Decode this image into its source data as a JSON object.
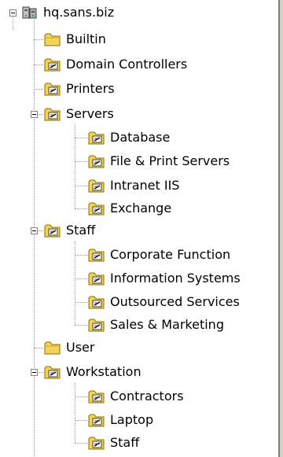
{
  "tree": {
    "root": {
      "label": "hq.sans.biz",
      "icon": "domain-icon"
    },
    "builtin": {
      "label": "Builtin",
      "icon": "folder-icon"
    },
    "domain_controllers": {
      "label": "Domain Controllers",
      "icon": "ou-folder-icon"
    },
    "printers": {
      "label": "Printers",
      "icon": "ou-folder-icon"
    },
    "servers": {
      "label": "Servers",
      "icon": "ou-folder-icon",
      "children": [
        {
          "label": "Database"
        },
        {
          "label": "File & Print Servers"
        },
        {
          "label": "Intranet IIS"
        },
        {
          "label": "Exchange"
        }
      ]
    },
    "staff": {
      "label": "Staff",
      "icon": "ou-folder-icon",
      "children": [
        {
          "label": "Corporate Function"
        },
        {
          "label": "Information Systems"
        },
        {
          "label": "Outsourced Services"
        },
        {
          "label": "Sales & Marketing"
        }
      ]
    },
    "user": {
      "label": "User",
      "icon": "folder-icon"
    },
    "workstation": {
      "label": "Workstation",
      "icon": "ou-folder-icon",
      "children": [
        {
          "label": "Contractors"
        },
        {
          "label": "Laptop"
        },
        {
          "label": "Staff"
        }
      ]
    }
  }
}
